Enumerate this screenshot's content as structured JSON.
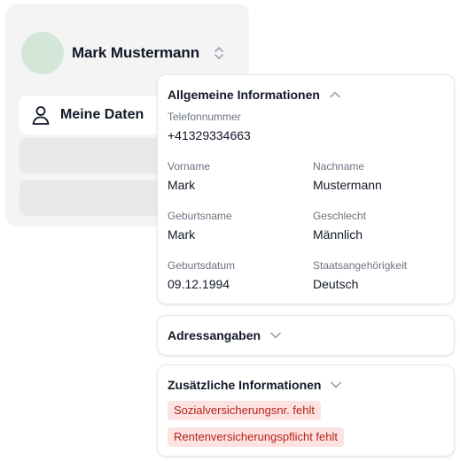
{
  "profile": {
    "name": "Mark Mustermann"
  },
  "nav": {
    "active_label": "Meine Daten"
  },
  "general_info": {
    "title": "Allgemeine Informationen",
    "phone": {
      "label": "Telefonnummer",
      "value": "+41329334663"
    },
    "first_name": {
      "label": "Vorname",
      "value": "Mark"
    },
    "last_name": {
      "label": "Nachname",
      "value": "Mustermann"
    },
    "birth_name": {
      "label": "Geburtsname",
      "value": "Mark"
    },
    "gender": {
      "label": "Geschlecht",
      "value": "Männlich"
    },
    "birth_date": {
      "label": "Geburtsdatum",
      "value": "09.12.1994"
    },
    "nationality": {
      "label": "Staatsangehörigkeit",
      "value": "Deutsch"
    }
  },
  "address": {
    "title": "Adressangaben"
  },
  "additional_info": {
    "title": "Zusätzliche Informationen",
    "badges": [
      "Sozialversicherungsnr. fehlt",
      "Rentenversicherungspflicht fehlt"
    ]
  },
  "colors": {
    "avatar_bg": "#d4e6d8",
    "badge_bg": "#fde2e2",
    "badge_text": "#b42318"
  }
}
